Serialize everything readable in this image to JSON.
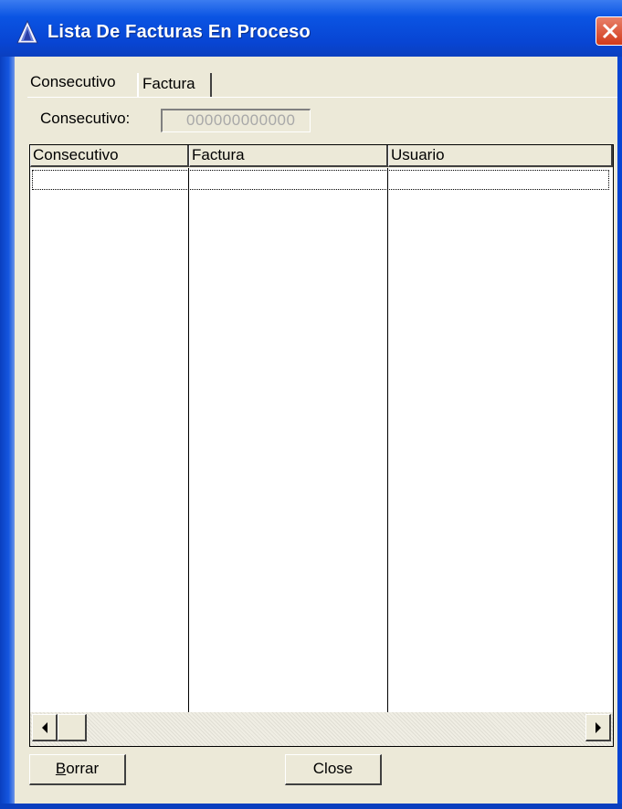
{
  "window": {
    "title": "Lista De Facturas En Proceso",
    "title_icon": "triangle-app-icon",
    "close_icon": "close-icon"
  },
  "tabs": [
    {
      "label": "Consecutivo",
      "active": true
    },
    {
      "label": "Factura",
      "active": false
    }
  ],
  "form": {
    "consecutivo_label": "Consecutivo:",
    "consecutivo_value": "000000000000"
  },
  "table": {
    "columns": [
      "Consecutivo",
      "Factura",
      "Usuario"
    ],
    "rows": []
  },
  "scrollbar": {
    "left_arrow_icon": "arrow-left-icon",
    "right_arrow_icon": "arrow-right-icon"
  },
  "buttons": {
    "borrar_accel": "B",
    "borrar_rest": "orrar",
    "close_label": "Close"
  },
  "colors": {
    "titlebar": "#0a54e3",
    "face": "#ece9d8",
    "close": "#d23a1a"
  }
}
